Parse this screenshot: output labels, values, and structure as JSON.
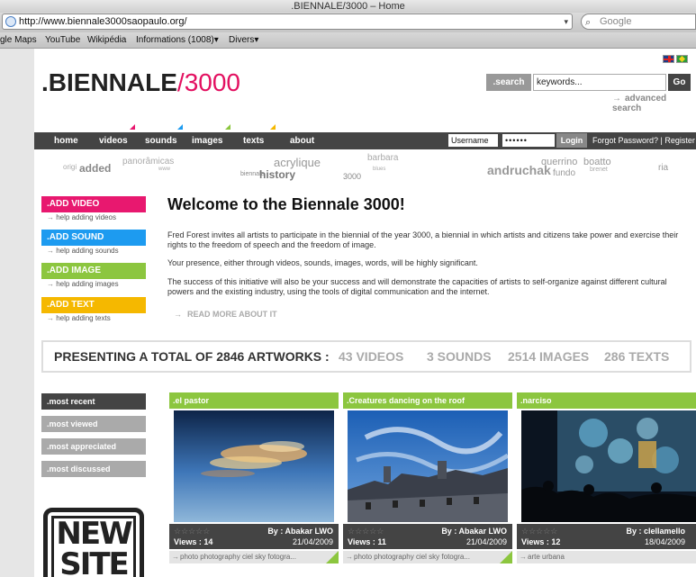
{
  "browser": {
    "title": ".BIENNALE/3000 – Home",
    "url": "http://www.biennale3000saopaulo.org/",
    "search_placeholder": "Google",
    "bookmarks": [
      "gle Maps",
      "YouTube",
      "Wikipédia",
      "Informations (1008)▾",
      "Divers▾"
    ]
  },
  "header": {
    "logo_prefix": ".BIENNALE",
    "logo_slash": "/",
    "logo_num": "3000",
    "search_label": ".search",
    "search_value": "keywords...",
    "go_label": "Go",
    "advanced_search": "advanced search"
  },
  "nav": {
    "items": [
      "home",
      "videos",
      "sounds",
      "images",
      "texts",
      "about"
    ],
    "username_value": "Username",
    "password_value": "••••••",
    "login_label": "Login",
    "forgot_text": "Forgot Password? | Register"
  },
  "tags": [
    "origi",
    "added",
    "panorâmicas",
    "www",
    "acrylique",
    "history",
    "biennale",
    "3000",
    "barbara",
    "blues",
    "andruchak",
    "querrino",
    "boatto",
    "fundo",
    "brenet",
    "ria"
  ],
  "left_actions": [
    {
      "label": ".ADD VIDEO",
      "help": "help adding videos",
      "color": "#e8186f"
    },
    {
      "label": ".ADD SOUND",
      "help": "help adding sounds",
      "color": "#1d9bf0"
    },
    {
      "label": ".ADD IMAGE",
      "help": "help adding images",
      "color": "#8cc63f"
    },
    {
      "label": ".ADD TEXT",
      "help": "help adding texts",
      "color": "#f5b800"
    }
  ],
  "welcome": {
    "title": "Welcome to the Biennale 3000!",
    "p1": "Fred Forest invites all artists to participate in the biennial of the year 3000, a biennial in which artists and citizens take power and exercise their rights to the freedom of speech and the freedom of image.",
    "p2": "Your presence, either through videos, sounds, images, words, will be highly significant.",
    "p3": "The success of this initiative will also be your success and will demonstrate the capacities of artists to self-organize against different cultural powers and the existing industry, using the tools of digital communication and the internet.",
    "read_more": "READ MORE ABOUT IT"
  },
  "totals": {
    "main": "PRESENTING A TOTAL OF 2846 ARTWORKS :",
    "videos": "43 VIDEOS",
    "sounds": "3 SOUNDS",
    "images": "2514 IMAGES",
    "texts": "286 TEXTS"
  },
  "sort_tabs": [
    ".most recent",
    ".most viewed",
    ".most appreciated",
    ".most discussed"
  ],
  "newsite": {
    "line1": "NEW",
    "line2": "SITE"
  },
  "cards": [
    {
      "title": ".el pastor",
      "by": "By : Abakar LWO",
      "views": "Views : 14",
      "date": "21/04/2009",
      "tags": "photo photography ciel sky fotogra...",
      "stars": "☆☆☆☆☆"
    },
    {
      "title": ".Creatures dancing on the roof",
      "by": "By : Abakar LWO",
      "views": "Views : 11",
      "date": "21/04/2009",
      "tags": "photo photography ciel sky fotogra...",
      "stars": "☆☆☆☆☆"
    },
    {
      "title": ".narciso",
      "by": "By : clellamello",
      "views": "Views : 12",
      "date": "18/04/2009",
      "tags": "arte urbana",
      "stars": "☆☆☆☆☆"
    }
  ]
}
